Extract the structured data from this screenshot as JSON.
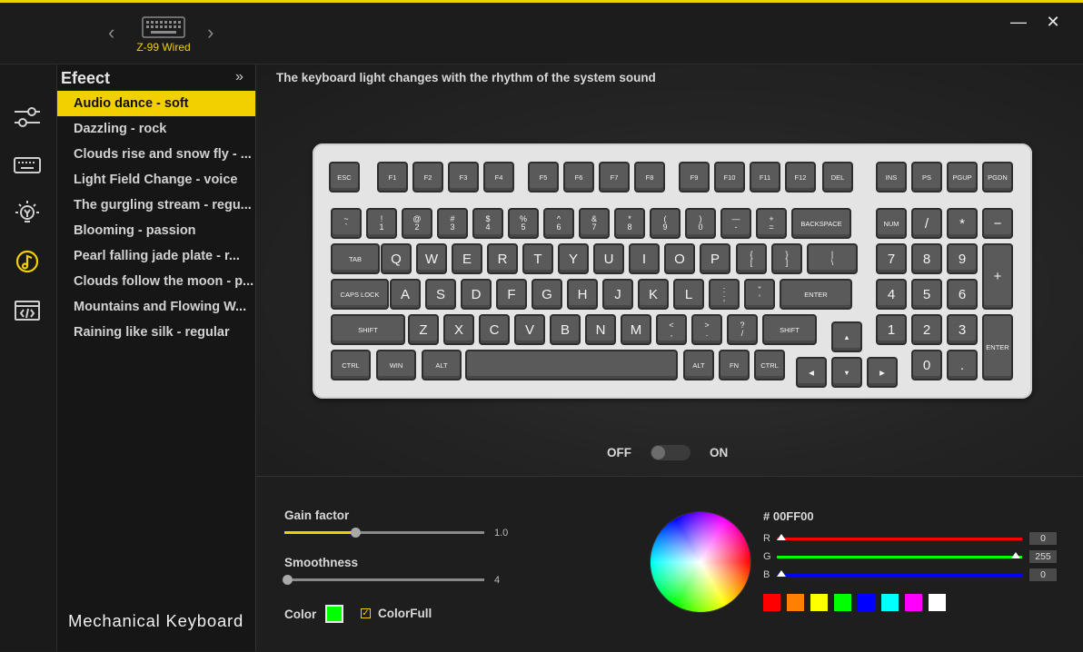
{
  "device": {
    "name": "Z-99 Wired"
  },
  "window": {
    "minimize": "—",
    "close": "✕"
  },
  "sidebar": {
    "icons": [
      "sliders-icon",
      "keyboard-icon",
      "lightbulb-icon",
      "music-note-icon",
      "code-icon"
    ]
  },
  "effects": {
    "title": "Efeect",
    "collapse": "»",
    "items": [
      "Audio dance - soft",
      "Dazzling - rock",
      "Clouds rise and snow fly - ...",
      "Light Field Change - voice",
      "The gurgling stream - regu...",
      "Blooming - passion",
      "Pearl falling jade plate - r...",
      "Clouds follow the moon - p...",
      "Mountains and Flowing W...",
      "Raining like silk - regular"
    ],
    "active_index": 0
  },
  "brand": "Mechanical Keyboard",
  "main": {
    "description": "The keyboard light changes with the rhythm of the system sound",
    "toggle": {
      "off_label": "OFF",
      "on_label": "ON",
      "state": "off"
    }
  },
  "keyboard": {
    "row0": [
      "ESC",
      "F1",
      "F2",
      "F3",
      "F4",
      "F5",
      "F6",
      "F7",
      "F8",
      "F9",
      "F10",
      "F11",
      "F12",
      "DEL",
      "INS",
      "PS",
      "PGUP",
      "PGDN"
    ],
    "row1_top": [
      "~",
      "!",
      "@",
      "#",
      "$",
      "%",
      "^",
      "&",
      "*",
      "(",
      ")",
      "—",
      "+"
    ],
    "row1_bottom": [
      "`",
      "1",
      "2",
      "3",
      "4",
      "5",
      "6",
      "7",
      "8",
      "9",
      "0",
      "-",
      "="
    ],
    "row1_extra": [
      "BACKSPACE",
      "NUM",
      "/",
      "*",
      "−"
    ],
    "row2": [
      "TAB",
      "Q",
      "W",
      "E",
      "R",
      "T",
      "Y",
      "U",
      "I",
      "O",
      "P",
      "7",
      "8",
      "9",
      "+"
    ],
    "row2_dual_top": [
      "{",
      "}",
      "|"
    ],
    "row2_dual_bottom": [
      "[",
      "]",
      "\\"
    ],
    "row3": [
      "CAPS LOCK",
      "A",
      "S",
      "D",
      "F",
      "G",
      "H",
      "J",
      "K",
      "L",
      "ENTER",
      "4",
      "5",
      "6"
    ],
    "row3_dual_top": [
      ":",
      "\""
    ],
    "row3_dual_bottom": [
      ";",
      "'"
    ],
    "row4": [
      "SHIFT",
      "Z",
      "X",
      "C",
      "V",
      "B",
      "N",
      "M",
      "SHIFT",
      "▲",
      "1",
      "2",
      "3",
      "ENTER"
    ],
    "row4_dual_top": [
      "<",
      ">",
      "?"
    ],
    "row4_dual_bottom": [
      ",",
      ".",
      "/"
    ],
    "row5": [
      "CTRL",
      "WIN",
      "ALT",
      "",
      "ALT",
      "FN",
      "CTRL",
      "◀",
      "▼",
      "▶",
      "0",
      "."
    ]
  },
  "controls": {
    "gain": {
      "label": "Gain factor",
      "value": "1.0",
      "fraction": 0.34
    },
    "smooth": {
      "label": "Smoothness",
      "value": "4",
      "fraction": 0.0
    },
    "color": {
      "label": "Color",
      "value": "#00FF00"
    },
    "colorfull": {
      "label": "ColorFull",
      "checked": true,
      "check_mark": "✓"
    }
  },
  "picker": {
    "hex": "# 00FF00",
    "r": {
      "label": "R",
      "value": "0",
      "color": "#ff0000"
    },
    "g": {
      "label": "G",
      "value": "255",
      "color": "#00ff00"
    },
    "b": {
      "label": "B",
      "value": "0",
      "color": "#0000ff"
    },
    "presets": [
      "#ff0000",
      "#ff8000",
      "#ffff00",
      "#00ff00",
      "#0000ff",
      "#00ffff",
      "#ff00ff",
      "#ffffff"
    ]
  },
  "colors": {
    "accent": "#f2d000",
    "background": "#1b1b1b"
  }
}
